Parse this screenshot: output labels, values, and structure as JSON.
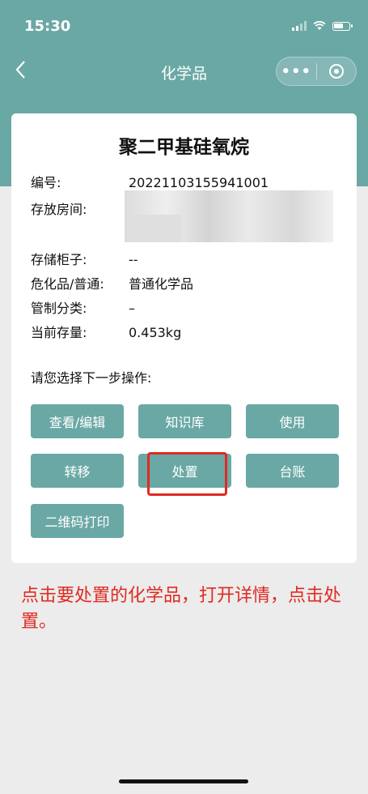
{
  "status": {
    "time": "15:30"
  },
  "nav": {
    "title": "化学品",
    "back_icon": "chevron-left-icon",
    "more_label": "•••"
  },
  "chemical": {
    "name": "聚二甲基硅氧烷",
    "fields": [
      {
        "label": "编号:",
        "value": "20221103155941001"
      },
      {
        "label": "存放房间:",
        "value": ""
      },
      {
        "label": "存储柜子:",
        "value": "--"
      },
      {
        "label": "危化品/普通:",
        "value": "普通化学品"
      },
      {
        "label": "管制分类:",
        "value": "–"
      },
      {
        "label": "当前存量:",
        "value": "0.453kg"
      }
    ]
  },
  "actions": {
    "prompt": "请您选择下一步操作:",
    "buttons": [
      "查看/编辑",
      "知识库",
      "使用",
      "转移",
      "处置",
      "台账",
      "二维码打印"
    ]
  },
  "instruction": "点击要处置的化学品，打开详情，点击处置。",
  "colors": {
    "accent": "#6aa8a5",
    "highlight": "#e02a22"
  }
}
